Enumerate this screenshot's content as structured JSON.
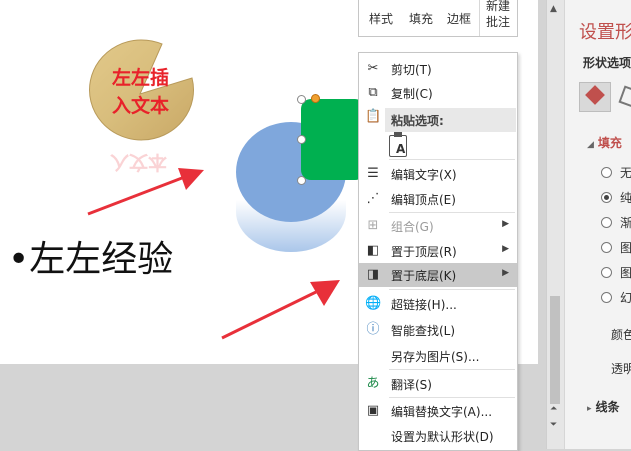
{
  "slide": {
    "textbox": [
      "左左插",
      "入文本"
    ],
    "bullet_text": "•左左经验"
  },
  "minitoolbar": {
    "style_label": "样式",
    "fill_label": "填充",
    "border_label": "边框",
    "new_comment_label": [
      "新建",
      "批注"
    ]
  },
  "context_menu": {
    "items": [
      {
        "label": "剪切(T)",
        "icon": "scissors-icon",
        "enabled": true
      },
      {
        "label": "复制(C)",
        "icon": "copy-icon",
        "enabled": true
      },
      {
        "label": "粘贴选项:",
        "icon": "paste-icon",
        "enabled": true,
        "header": true
      },
      {
        "label": "编辑文字(X)",
        "icon": "edit-text-icon",
        "enabled": true
      },
      {
        "label": "编辑顶点(E)",
        "icon": "edit-points-icon",
        "enabled": true
      },
      {
        "label": "组合(G)",
        "icon": "group-icon",
        "enabled": false,
        "submenu": true
      },
      {
        "label": "置于顶层(R)",
        "icon": "bring-front-icon",
        "enabled": true,
        "submenu": true
      },
      {
        "label": "置于底层(K)",
        "icon": "send-back-icon",
        "enabled": true,
        "submenu": true,
        "highlighted": true
      },
      {
        "label": "超链接(H)...",
        "icon": "hyperlink-icon",
        "enabled": true
      },
      {
        "label": "智能查找(L)",
        "icon": "smart-lookup-icon",
        "enabled": true
      },
      {
        "label": "另存为图片(S)...",
        "icon": "",
        "enabled": true
      },
      {
        "label": "翻译(S)",
        "icon": "translate-icon",
        "enabled": true
      },
      {
        "label": "编辑替换文字(A)...",
        "icon": "alt-text-icon",
        "enabled": true
      },
      {
        "label": "设置为默认形状(D)",
        "icon": "",
        "enabled": true
      }
    ]
  },
  "pane": {
    "title": "设置形",
    "subtitle": "形状选项",
    "fill_section": "填充",
    "fill_options": [
      "无",
      "纯",
      "渐",
      "图",
      "图",
      "幻"
    ],
    "selected_fill_index": 1,
    "color_label": "颜色",
    "transparency_label": "透明",
    "lines_section": "线条"
  },
  "colors": {
    "accent": "#c0504d",
    "green_shape": "#00b050",
    "blue_shape": "#7fa7dc",
    "textbox_red": "#e8222a",
    "arrow_red": "#e8303a"
  }
}
